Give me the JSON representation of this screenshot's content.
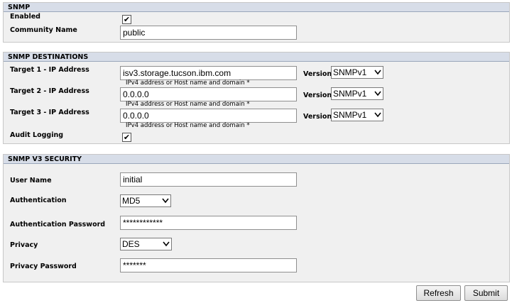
{
  "snmp": {
    "title": "SNMP",
    "enabled_label": "Enabled",
    "enabled_check": "✔",
    "community_label": "Community Name",
    "community_value": "public"
  },
  "destinations": {
    "title": "SNMP DESTINATIONS",
    "hint": "IPv4 address or Host name and domain *",
    "version_label": "Version",
    "targets": [
      {
        "label": "Target 1 - IP Address",
        "value": "isv3.storage.tucson.ibm.com",
        "version": "SNMPv1"
      },
      {
        "label": "Target 2 - IP Address",
        "value": "0.0.0.0",
        "version": "SNMPv1"
      },
      {
        "label": "Target 3 - IP Address",
        "value": "0.0.0.0",
        "version": "SNMPv1"
      }
    ],
    "audit_label": "Audit Logging",
    "audit_check": "✔"
  },
  "v3": {
    "title": "SNMP V3 SECURITY",
    "user_label": "User Name",
    "user_value": "initial",
    "auth_label": "Authentication",
    "auth_value": "MD5",
    "auth_pw_label": "Authentication Password",
    "auth_pw_value": "************",
    "privacy_label": "Privacy",
    "privacy_value": "DES",
    "privacy_pw_label": "Privacy Password",
    "privacy_pw_value": "*******"
  },
  "buttons": {
    "refresh": "Refresh",
    "submit": "Submit"
  },
  "icons": {
    "checkbox_checked": "check-icon",
    "dropdown": "chevron-down-icon"
  }
}
